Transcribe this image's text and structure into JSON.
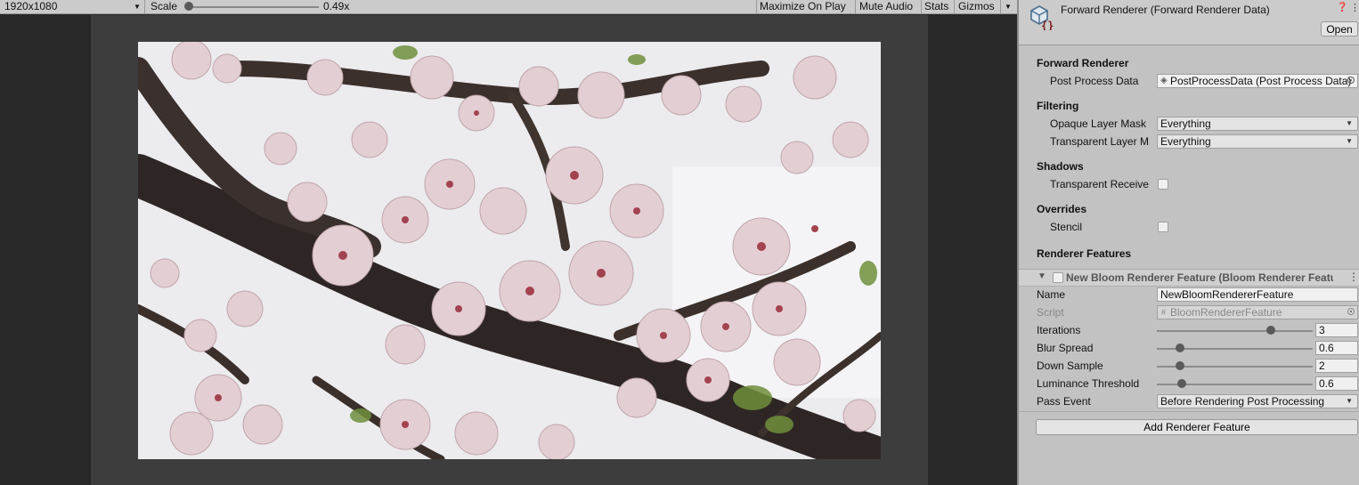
{
  "game_toolbar": {
    "resolution": "1920x1080",
    "scale_label": "Scale",
    "scale_value": "0.49x",
    "scale_fraction": 0.0,
    "buttons": [
      "Maximize On Play",
      "Mute Audio",
      "Stats",
      "Gizmos"
    ]
  },
  "inspector": {
    "title": "Forward Renderer (Forward Renderer Data)",
    "open_label": "Open",
    "forward_renderer": {
      "header": "Forward Renderer",
      "post_process_label": "Post Process Data",
      "post_process_value": "PostProcessData (Post Process Data)"
    },
    "filtering": {
      "header": "Filtering",
      "opaque_label": "Opaque Layer Mask",
      "opaque_value": "Everything",
      "transparent_label": "Transparent Layer M",
      "transparent_value": "Everything"
    },
    "shadows": {
      "header": "Shadows",
      "receive_label": "Transparent Receive"
    },
    "overrides": {
      "header": "Overrides",
      "stencil_label": "Stencil"
    },
    "renderer_features": {
      "header": "Renderer Features",
      "feature_title": "New Bloom Renderer Feature (Bloom Renderer Feature)",
      "name_label": "Name",
      "name_value": "NewBloomRendererFeature",
      "script_label": "Script",
      "script_value": "BloomRendererFeature",
      "iterations_label": "Iterations",
      "iterations_value": "3",
      "iterations_fraction": 0.73,
      "blur_label": "Blur Spread",
      "blur_value": "0.6",
      "blur_fraction": 0.15,
      "down_label": "Down Sample",
      "down_value": "2",
      "down_fraction": 0.15,
      "lum_label": "Luminance Threshold",
      "lum_value": "0.6",
      "lum_fraction": 0.16,
      "pass_label": "Pass Event",
      "pass_value": "Before Rendering Post Processing",
      "add_label": "Add Renderer Feature"
    }
  }
}
